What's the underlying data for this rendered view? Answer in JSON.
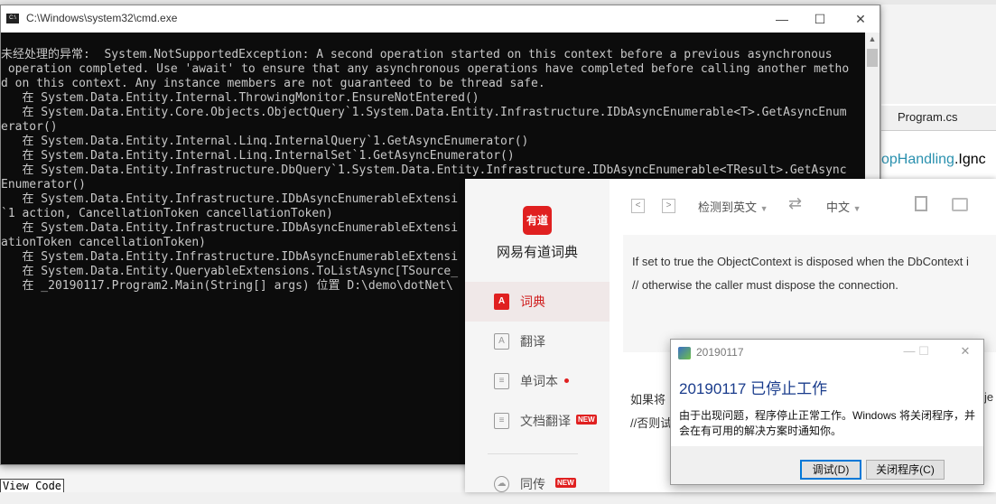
{
  "cmd": {
    "title": "C:\\Windows\\system32\\cmd.exe",
    "icon": "cmd-icon",
    "controls": {
      "minimize": "—",
      "maximize": "☐",
      "close": "✕"
    },
    "lines": [
      "未经处理的异常:  System.NotSupportedException: A second operation started on this context before a previous asynchronous",
      " operation completed. Use 'await' to ensure that any asynchronous operations have completed before calling another metho",
      "d on this context. Any instance members are not guaranteed to be thread safe.",
      "   在 System.Data.Entity.Internal.ThrowingMonitor.EnsureNotEntered()",
      "   在 System.Data.Entity.Core.Objects.ObjectQuery`1.System.Data.Entity.Infrastructure.IDbAsyncEnumerable<T>.GetAsyncEnum",
      "erator()",
      "   在 System.Data.Entity.Internal.Linq.InternalQuery`1.GetAsyncEnumerator()",
      "   在 System.Data.Entity.Internal.Linq.InternalSet`1.GetAsyncEnumerator()",
      "   在 System.Data.Entity.Infrastructure.DbQuery`1.System.Data.Entity.Infrastructure.IDbAsyncEnumerable<TResult>.GetAsync",
      "Enumerator()",
      "   在 System.Data.Entity.Infrastructure.IDbAsyncEnumerableExtensi",
      "`1 action, CancellationToken cancellationToken)",
      "   在 System.Data.Entity.Infrastructure.IDbAsyncEnumerableExtensi",
      "ationToken cancellationToken)",
      "   在 System.Data.Entity.Infrastructure.IDbAsyncEnumerableExtensi",
      "   在 System.Data.Entity.QueryableExtensions.ToListAsync[TSource_",
      "   在 _20190117.Program2.Main(String[] args) 位置 D:\\demo\\dotNet\\"
    ]
  },
  "vs": {
    "tab": "Program.cs",
    "code_type": "opHandling",
    "code_member": ".Ignc",
    "view_code": "View Code"
  },
  "youdao": {
    "logo_text": "有道",
    "app_name": "网易有道词典",
    "nav": [
      {
        "label": "词典",
        "icon": "A"
      },
      {
        "label": "翻译",
        "icon": "A"
      },
      {
        "label": "单词本",
        "icon": "≡"
      },
      {
        "label": "文档翻译",
        "icon": "≡",
        "badge": "NEW"
      },
      {
        "label": "同传",
        "icon": "☁",
        "badge": "NEW"
      }
    ],
    "toolbar": {
      "back": "<",
      "forward": ">",
      "source_lang": "检测到英文",
      "swap": "⇄",
      "target_lang": "中文"
    },
    "input_lines": [
      "If set to true the ObjectContext is disposed when the DbContext i",
      "//     otherwise the caller must dispose the connection."
    ],
    "output_lines": [
      "如果将",
      "//否则试"
    ],
    "output_right": "je"
  },
  "dialog": {
    "title": "20190117",
    "heading": "20190117 已停止工作",
    "message": "由于出现问题，程序停止正常工作。Windows 将关闭程序，并会在有可用的解决方案时通知你。",
    "debug_button": "调试(D)",
    "close_button": "关闭程序(C)",
    "controls": {
      "minimize": "—",
      "maximize": "☐",
      "close": "✕"
    }
  }
}
